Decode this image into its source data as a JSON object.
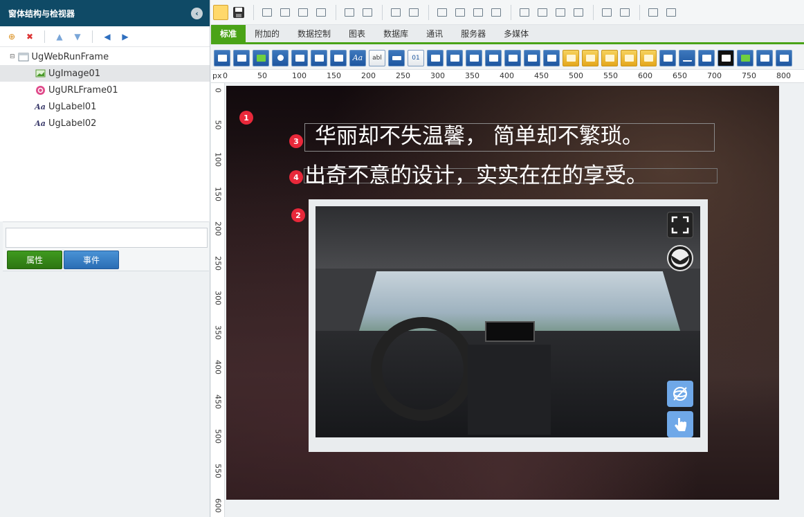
{
  "left_panel": {
    "title": "窗体结构与检视器",
    "tree": [
      {
        "label": "UgWebRunFrame",
        "icon": "form-icon"
      },
      {
        "label": "UgImage01",
        "icon": "image-icon",
        "selected": true
      },
      {
        "label": "UgURLFrame01",
        "icon": "url-frame-icon"
      },
      {
        "label": "UgLabel01",
        "icon": "label-icon"
      },
      {
        "label": "UgLabel02",
        "icon": "label-icon"
      }
    ],
    "search_value": "",
    "properties_tab": "属性",
    "events_tab": "事件"
  },
  "tabs": [
    "标准",
    "附加的",
    "数据控制",
    "图表",
    "数据库",
    "通讯",
    "服务器",
    "多媒体"
  ],
  "active_tab": "标准",
  "ruler": {
    "unit": "px",
    "h_ticks": [
      "0",
      "50",
      "100",
      "150",
      "200",
      "250",
      "300",
      "350",
      "400",
      "450",
      "500",
      "550",
      "600",
      "650",
      "700",
      "750",
      "800"
    ],
    "v_ticks": [
      "0",
      "50",
      "100",
      "150",
      "200",
      "250",
      "300",
      "350",
      "400",
      "450",
      "500",
      "550",
      "600"
    ]
  },
  "canvas": {
    "label1_text": "华丽却不失温馨， 简单却不繁琐。",
    "label2_text": "出奇不意的设计，实实在在的享受。",
    "badges": [
      "1",
      "2",
      "3",
      "4"
    ]
  },
  "colors": {
    "accent_green": "#4aa317",
    "header_blue": "#0f4a66",
    "badge_red": "#e8283a"
  }
}
